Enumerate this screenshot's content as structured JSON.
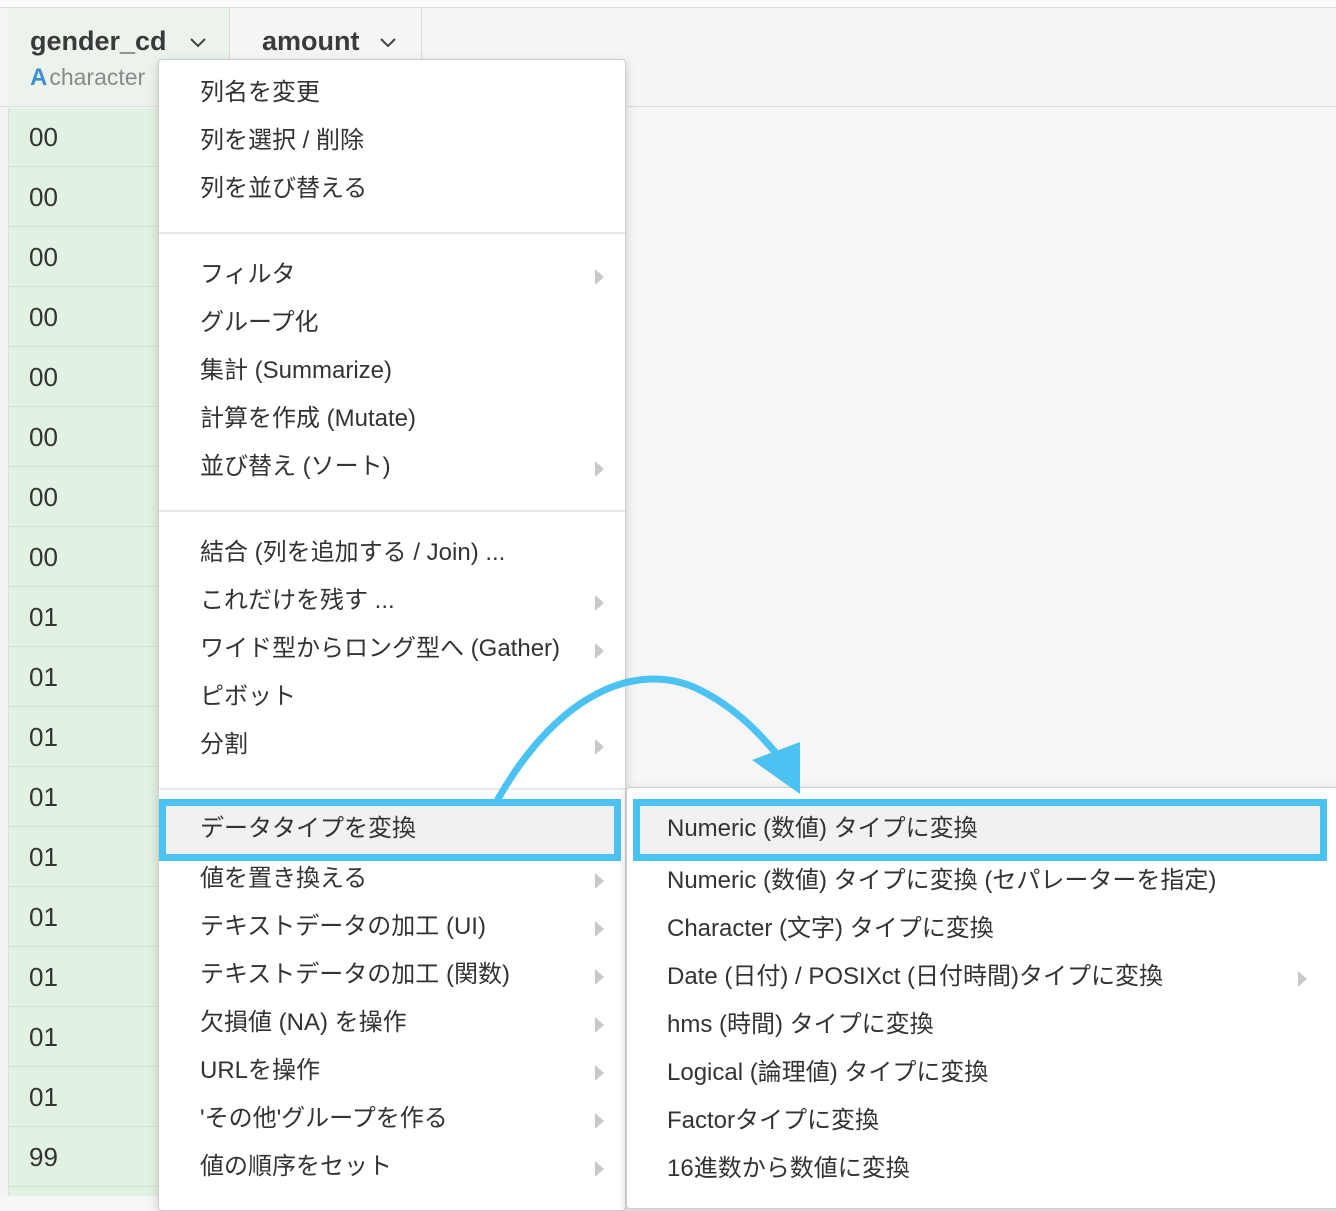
{
  "columns": [
    {
      "name": "gender_cd",
      "type_letter": "A",
      "type": "character"
    },
    {
      "name": "amount"
    }
  ],
  "rows": [
    "00",
    "00",
    "00",
    "00",
    "00",
    "00",
    "00",
    "00",
    "01",
    "01",
    "01",
    "01",
    "01",
    "01",
    "01",
    "01",
    "01",
    "99"
  ],
  "menu": {
    "group1": [
      "列名を変更",
      "列を選択 / 削除",
      "列を並び替える"
    ],
    "group2": [
      "フィルタ",
      "グループ化",
      "集計 (Summarize)",
      "計算を作成 (Mutate)",
      "並び替え (ソート)"
    ],
    "group3": [
      "結合 (列を追加する / Join) ...",
      "これだけを残す ...",
      "ワイド型からロング型へ (Gather)",
      "ピボット",
      "分割"
    ],
    "group4": [
      "データタイプを変換",
      "値を置き換える",
      "テキストデータの加工 (UI)",
      "テキストデータの加工 (関数)",
      "欠損値 (NA) を操作",
      "URLを操作",
      "'その他'グループを作る",
      "値の順序をセット"
    ]
  },
  "submenu": [
    "Numeric (数値) タイプに変換",
    "Numeric (数値) タイプに変換 (セパレーターを指定)",
    "Character (文字) タイプに変換",
    "Date (日付) / POSIXct (日付時間)タイプに変換",
    "hms (時間) タイプに変換",
    "Logical (論理値) タイプに変換",
    "Factorタイプに変換",
    "16進数から数値に変換"
  ],
  "colors": {
    "highlight": "#4cc2f2",
    "column_bg": "#e2f2e2",
    "type_letter": "#3d8fd6"
  }
}
